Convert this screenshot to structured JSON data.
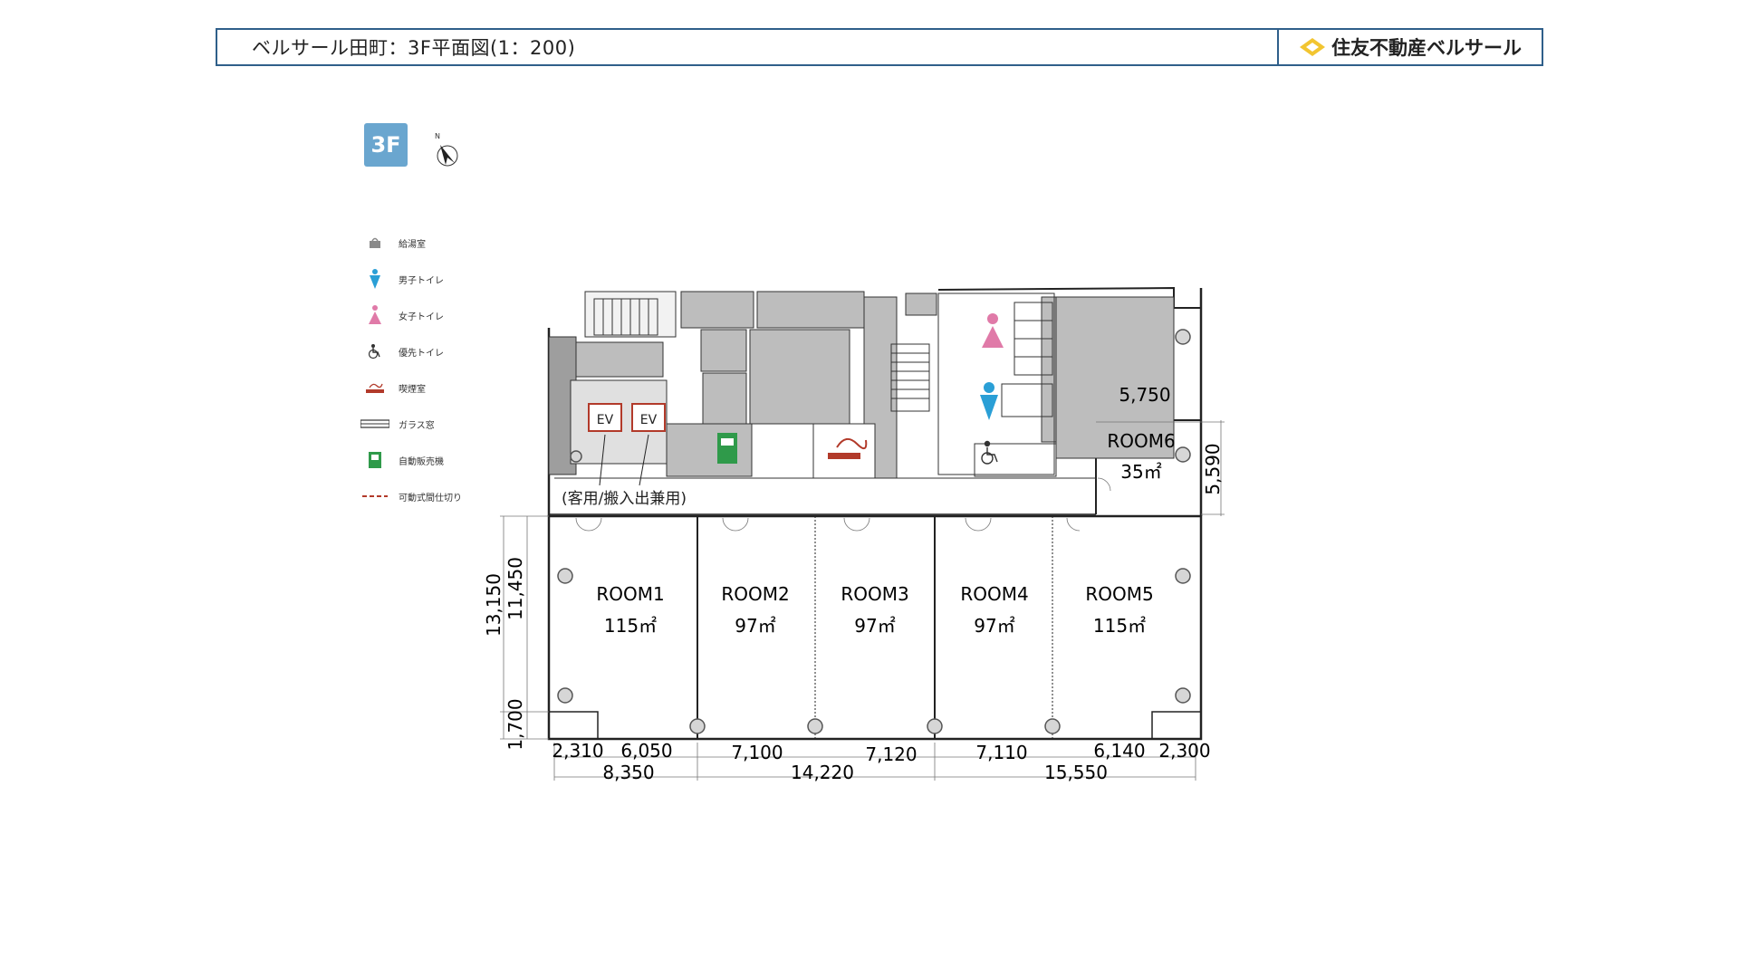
{
  "header": {
    "title": "ベルサール田町：3F平面図(1：200)",
    "brand": "住友不動産ベルサール"
  },
  "floor_label": "3F",
  "north_label": "N",
  "legend": [
    {
      "icon": "kitchenette-icon",
      "label": "給湯室"
    },
    {
      "icon": "mens-restroom-icon",
      "label": "男子トイレ"
    },
    {
      "icon": "womens-restroom-icon",
      "label": "女子トイレ"
    },
    {
      "icon": "accessible-restroom-icon",
      "label": "優先トイレ"
    },
    {
      "icon": "smoking-room-icon",
      "label": "喫煙室"
    },
    {
      "icon": "glass-window-icon",
      "label": "ガラス窓"
    },
    {
      "icon": "vending-machine-icon",
      "label": "自動販売機"
    },
    {
      "icon": "movable-partition-icon",
      "label": "可動式間仕切り"
    }
  ],
  "colors": {
    "frame": "#2f5f8a",
    "badge": "#6aa6cf",
    "core_gray": "#bdbdbd",
    "core_dark": "#9e9e9e",
    "mens": "#2a9fd6",
    "womens": "#e07aa8",
    "smoking": "#b23a2a",
    "vending": "#2f9a4a",
    "brand_logo": "#f2c531"
  },
  "elevators": {
    "ev1": "EV",
    "ev2": "EV",
    "note": "(客用/搬入出兼用)"
  },
  "rooms": [
    {
      "name": "ROOM1",
      "area": "115㎡"
    },
    {
      "name": "ROOM2",
      "area": "97㎡"
    },
    {
      "name": "ROOM3",
      "area": "97㎡"
    },
    {
      "name": "ROOM4",
      "area": "97㎡"
    },
    {
      "name": "ROOM5",
      "area": "115㎡"
    },
    {
      "name": "ROOM6",
      "area": "35㎡"
    }
  ],
  "dimensions": {
    "room6_width": "5,750",
    "room6_depth": "5,590",
    "left_total": "13,150",
    "left_rooms": "11,450",
    "left_bottom": "1,700",
    "bottom_row1": [
      "2,310",
      "6,050",
      "7,100",
      "7,120",
      "7,110",
      "6,140",
      "2,300"
    ],
    "bottom_row2": [
      "8,350",
      "14,220",
      "15,550"
    ]
  }
}
